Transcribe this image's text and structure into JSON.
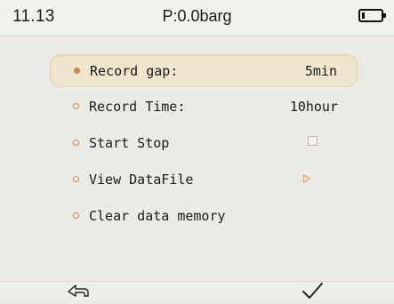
{
  "status": {
    "time": "11.13",
    "pressure": "P:0.0barg",
    "battery_icon": "battery-low-icon",
    "battery_level": 0.15
  },
  "menu": {
    "items": [
      {
        "label": "Record gap:",
        "value": "5min",
        "selected": true
      },
      {
        "label": "Record Time:",
        "value": "10hour",
        "selected": false
      },
      {
        "label": "Start Stop",
        "control": "checkbox",
        "checked": false
      },
      {
        "label": "View DataFile",
        "control": "arrow-right-icon"
      },
      {
        "label": "Clear data memory"
      }
    ]
  },
  "footer": {
    "back_icon": "back-arrow-icon",
    "confirm_icon": "checkmark-icon"
  },
  "colors": {
    "accent": "#c8894a",
    "selected_bg": "#f0e6cf",
    "background": "#eceae4"
  }
}
